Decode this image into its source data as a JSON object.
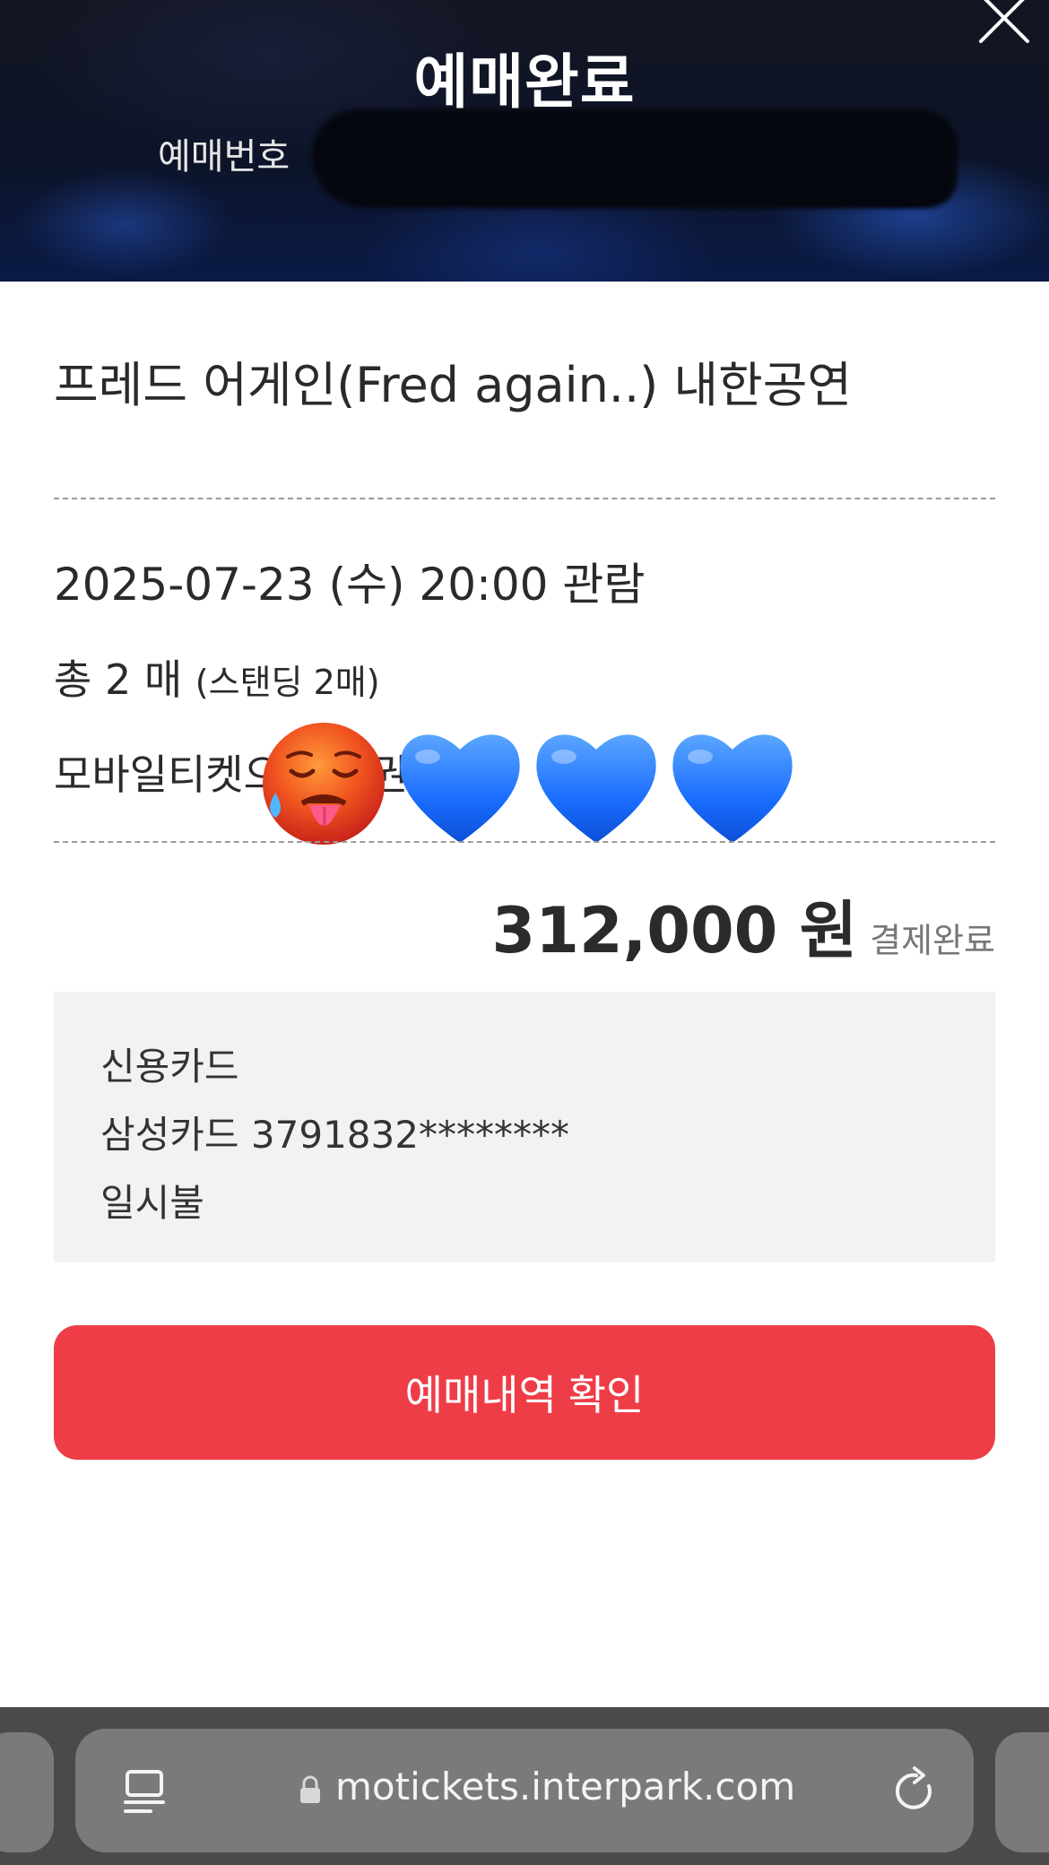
{
  "header": {
    "title": "예매완료",
    "order_number_label": "예매번호"
  },
  "ticket": {
    "event_title": "프레드 어게인(Fred again..) 내한공연",
    "date": "2025-07-23 (수) 20:00 관람",
    "count_main": "총 2 매",
    "count_detail": "(스탠딩 2매)",
    "delivery": "모바일티켓으로 발권"
  },
  "emojis": [
    "hot-face-emoji",
    "blue-heart-emoji",
    "blue-heart-emoji",
    "blue-heart-emoji"
  ],
  "payment": {
    "amount": "312,000 원",
    "status": "결제완료",
    "method": "신용카드",
    "card": "삼성카드 3791832********",
    "installment": "일시불"
  },
  "actions": {
    "confirm_label": "예매내역 확인"
  },
  "browser": {
    "url": "motickets.interpark.com"
  },
  "colors": {
    "accent_red": "#ee3d47",
    "blue_heart": "#1a6dff",
    "header_bg": "#0d1428"
  }
}
